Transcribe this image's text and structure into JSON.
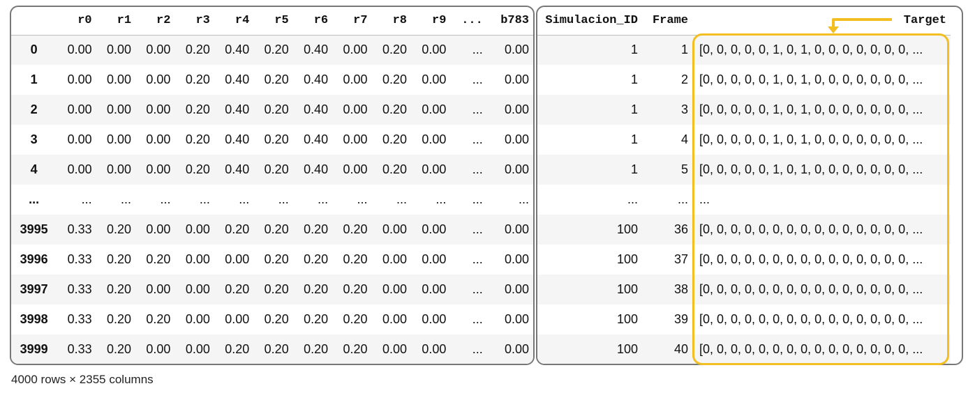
{
  "left_table": {
    "headers": [
      "",
      "r0",
      "r1",
      "r2",
      "r3",
      "r4",
      "r5",
      "r6",
      "r7",
      "r8",
      "r9",
      "...",
      "b783"
    ],
    "rows": [
      [
        "0",
        "0.00",
        "0.00",
        "0.00",
        "0.20",
        "0.40",
        "0.20",
        "0.40",
        "0.00",
        "0.20",
        "0.00",
        "...",
        "0.00"
      ],
      [
        "1",
        "0.00",
        "0.00",
        "0.00",
        "0.20",
        "0.40",
        "0.20",
        "0.40",
        "0.00",
        "0.20",
        "0.00",
        "...",
        "0.00"
      ],
      [
        "2",
        "0.00",
        "0.00",
        "0.00",
        "0.20",
        "0.40",
        "0.20",
        "0.40",
        "0.00",
        "0.20",
        "0.00",
        "...",
        "0.00"
      ],
      [
        "3",
        "0.00",
        "0.00",
        "0.00",
        "0.20",
        "0.40",
        "0.20",
        "0.40",
        "0.00",
        "0.20",
        "0.00",
        "...",
        "0.00"
      ],
      [
        "4",
        "0.00",
        "0.00",
        "0.00",
        "0.20",
        "0.40",
        "0.20",
        "0.40",
        "0.00",
        "0.20",
        "0.00",
        "...",
        "0.00"
      ],
      [
        "...",
        "...",
        "...",
        "...",
        "...",
        "...",
        "...",
        "...",
        "...",
        "...",
        "...",
        "...",
        "..."
      ],
      [
        "3995",
        "0.33",
        "0.20",
        "0.00",
        "0.00",
        "0.20",
        "0.20",
        "0.20",
        "0.20",
        "0.00",
        "0.00",
        "...",
        "0.00"
      ],
      [
        "3996",
        "0.33",
        "0.20",
        "0.20",
        "0.00",
        "0.00",
        "0.20",
        "0.20",
        "0.20",
        "0.00",
        "0.00",
        "...",
        "0.00"
      ],
      [
        "3997",
        "0.33",
        "0.20",
        "0.00",
        "0.00",
        "0.20",
        "0.20",
        "0.20",
        "0.20",
        "0.00",
        "0.00",
        "...",
        "0.00"
      ],
      [
        "3998",
        "0.33",
        "0.20",
        "0.20",
        "0.00",
        "0.00",
        "0.20",
        "0.20",
        "0.20",
        "0.00",
        "0.00",
        "...",
        "0.00"
      ],
      [
        "3999",
        "0.33",
        "0.20",
        "0.00",
        "0.00",
        "0.20",
        "0.20",
        "0.20",
        "0.20",
        "0.00",
        "0.00",
        "...",
        "0.00"
      ]
    ]
  },
  "right_table": {
    "headers": [
      "Simulacion_ID",
      "Frame",
      "Target"
    ],
    "rows": [
      [
        "1",
        "1",
        "[0, 0, 0, 0, 0, 1, 0, 1, 0, 0, 0, 0, 0, 0, 0, ..."
      ],
      [
        "1",
        "2",
        "[0, 0, 0, 0, 0, 1, 0, 1, 0, 0, 0, 0, 0, 0, 0, ..."
      ],
      [
        "1",
        "3",
        "[0, 0, 0, 0, 0, 1, 0, 1, 0, 0, 0, 0, 0, 0, 0, ..."
      ],
      [
        "1",
        "4",
        "[0, 0, 0, 0, 0, 1, 0, 1, 0, 0, 0, 0, 0, 0, 0, ..."
      ],
      [
        "1",
        "5",
        "[0, 0, 0, 0, 0, 1, 0, 1, 0, 0, 0, 0, 0, 0, 0, ..."
      ],
      [
        "...",
        "...",
        "..."
      ],
      [
        "100",
        "36",
        "[0, 0, 0, 0, 0, 0, 0, 0, 0, 0, 0, 0, 0, 0, 0, ..."
      ],
      [
        "100",
        "37",
        "[0, 0, 0, 0, 0, 0, 0, 0, 0, 0, 0, 0, 0, 0, 0, ..."
      ],
      [
        "100",
        "38",
        "[0, 0, 0, 0, 0, 0, 0, 0, 0, 0, 0, 0, 0, 0, 0, ..."
      ],
      [
        "100",
        "39",
        "[0, 0, 0, 0, 0, 0, 0, 0, 0, 0, 0, 0, 0, 0, 0, ..."
      ],
      [
        "100",
        "40",
        "[0, 0, 0, 0, 0, 0, 0, 0, 0, 0, 0, 0, 0, 0, 0, ..."
      ]
    ]
  },
  "footer": "4000 rows × 2355 columns",
  "colors": {
    "highlight": "#f2be22",
    "border": "#777777",
    "stripe": "#f5f5f5"
  },
  "icons": {
    "target_pointer": "arrow-down-icon"
  }
}
